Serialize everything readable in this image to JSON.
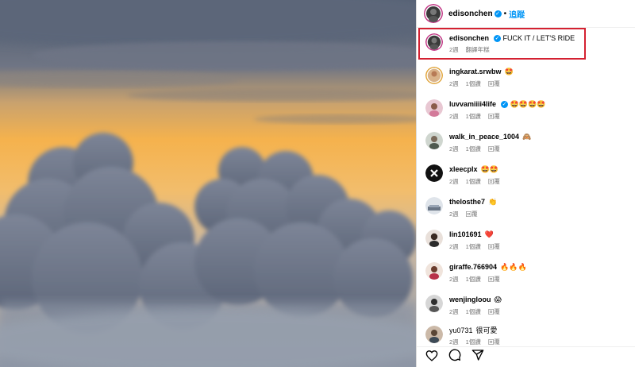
{
  "post": {
    "username": "edisonchen",
    "separator": "•",
    "follow_label": "追蹤",
    "caption_text": "FUCK IT / LET'S RIDE",
    "caption_time": "2週",
    "translate_label": "翻譯年糕"
  },
  "comments": [
    {
      "user": "ingkarat.srwbw",
      "text": "🤩",
      "time": "2週",
      "likes": "1個讚",
      "reply": "回覆"
    },
    {
      "user": "luvvamiiii4life",
      "text": "🤩🤩🤩🤩",
      "time": "2週",
      "likes": "1個讚",
      "reply": "回覆"
    },
    {
      "user": "walk_in_peace_1004",
      "text": "🙈",
      "time": "2週",
      "likes": "1個讚",
      "reply": "回覆"
    },
    {
      "user": "xleecplx",
      "text": "🤩🤩",
      "time": "2週",
      "likes": "1個讚",
      "reply": "回覆"
    },
    {
      "user": "thelosthe7",
      "text": "👏",
      "time": "2週",
      "likes": "",
      "reply": "回覆"
    },
    {
      "user": "lin101691",
      "text": "❤️",
      "time": "2週",
      "likes": "1個讚",
      "reply": "回覆"
    },
    {
      "user": "giraffe.766904",
      "text": "🔥🔥🔥",
      "time": "2週",
      "likes": "1個讚",
      "reply": "回覆"
    },
    {
      "user": "wenjingloou",
      "text": "😱",
      "time": "2週",
      "likes": "1個讚",
      "reply": "回覆"
    },
    {
      "user": "yu0731",
      "text": "很可愛",
      "time": "2週",
      "likes": "1個讚",
      "reply": "回覆"
    }
  ],
  "icons": [
    "heart-icon",
    "comment-icon",
    "share-icon"
  ],
  "colors": {
    "verified": "#0095f6",
    "follow": "#0095f6",
    "highlight": "#d42131",
    "meta": "#737373"
  }
}
